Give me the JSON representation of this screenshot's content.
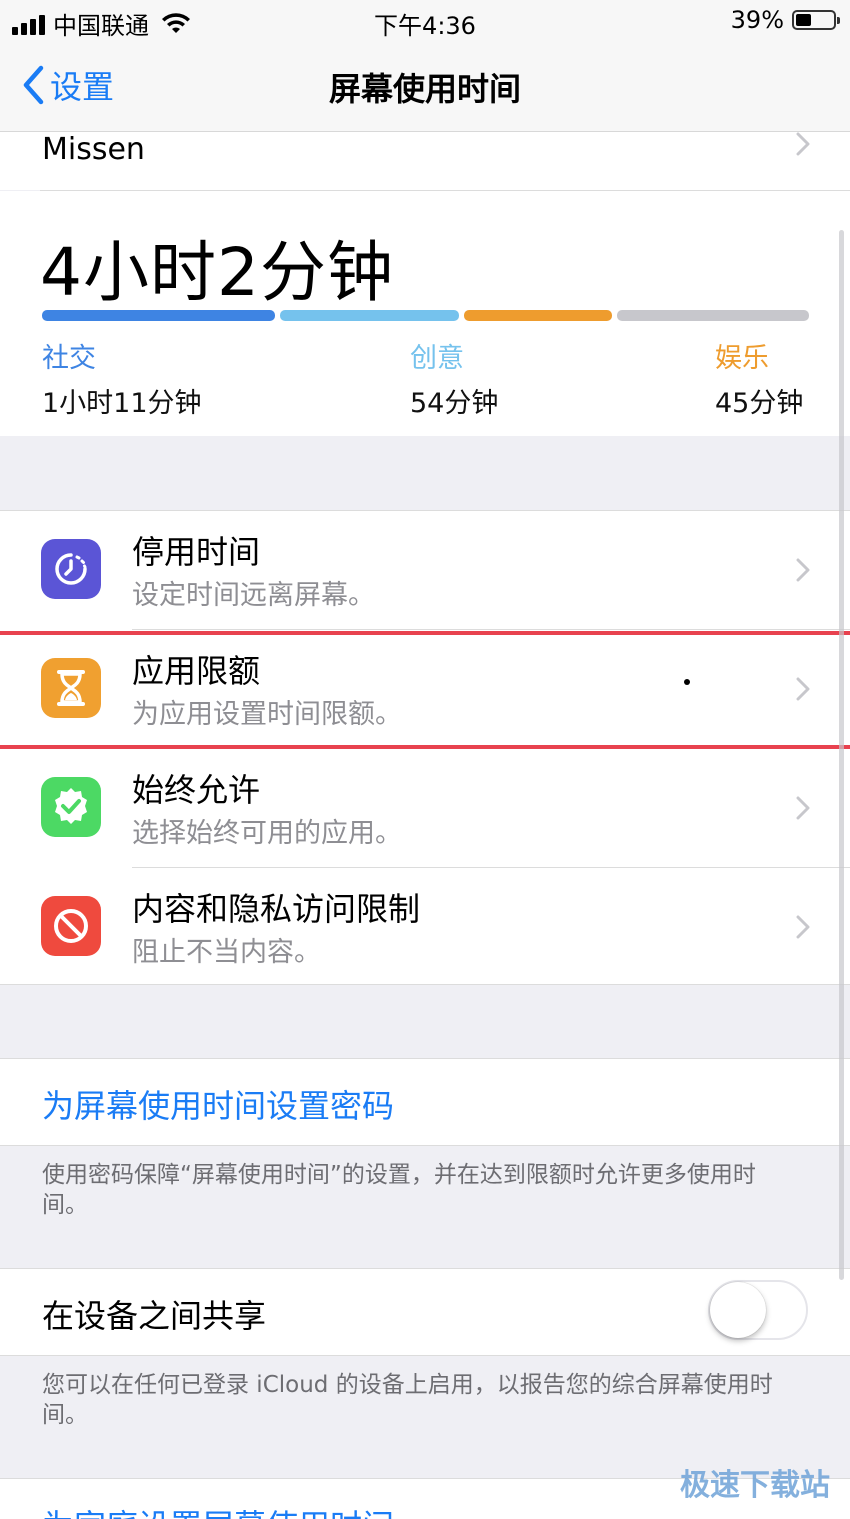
{
  "status_bar": {
    "carrier": "中国联通",
    "time": "下午4:36",
    "battery": "39%"
  },
  "nav": {
    "back_label": "设置",
    "title": "屏幕使用时间"
  },
  "device_name": "Missen",
  "usage": {
    "total": "4小时2分钟",
    "bar_fractions": {
      "social": 0.31,
      "creative": 0.24,
      "entertainment": 0.2,
      "other": 0.25
    },
    "categories": [
      {
        "label": "社交",
        "value": "1小时11分钟",
        "color": "#3e84e3"
      },
      {
        "label": "创意",
        "value": "54分钟",
        "color": "#75c2ed"
      },
      {
        "label": "娱乐",
        "value": "45分钟",
        "color": "#ee9c2e"
      }
    ],
    "other_color": "#c7c7cc"
  },
  "settings": [
    {
      "title": "停用时间",
      "subtitle": "设定时间远离屏幕。",
      "icon": "downtime-icon",
      "color": "#5b55d6"
    },
    {
      "title": "应用限额",
      "subtitle": "为应用设置时间限额。",
      "icon": "hourglass-icon",
      "color": "#f0a030"
    },
    {
      "title": "始终允许",
      "subtitle": "选择始终可用的应用。",
      "icon": "checkmark-badge-icon",
      "color": "#4cd964"
    },
    {
      "title": "内容和隐私访问限制",
      "subtitle": "阻止不当内容。",
      "icon": "prohibited-icon",
      "color": "#ef4a3e"
    }
  ],
  "passcode": {
    "link": "为屏幕使用时间设置密码",
    "footnote": "使用密码保障“屏幕使用时间”的设置，并在达到限额时允许更多使用时间。"
  },
  "share": {
    "label": "在设备之间共享",
    "enabled": false,
    "footnote": "您可以在任何已登录 iCloud 的设备上启用，以报告您的综合屏幕使用时间。"
  },
  "bottom_link": "为家庭设置屏幕使用时间",
  "watermark": "极速下载站"
}
